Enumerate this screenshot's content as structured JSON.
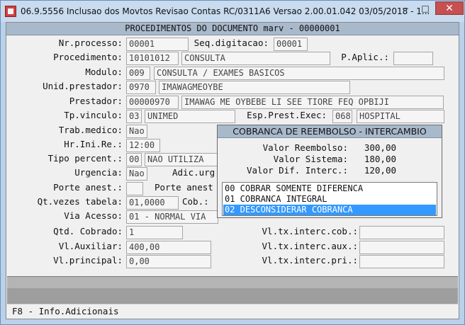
{
  "window": {
    "title": "06.9.5556  Inclusao  dos Movtos Revisao Contas RC/0311A6 Versao 2.00.01.042 03/05/2018 - 1...",
    "minimize": "─",
    "maximize": "□",
    "close": "✕"
  },
  "header": {
    "title": "PROCEDIMENTOS DO DOCUMENTO marv - 00000001"
  },
  "form": {
    "nr_processo": {
      "label": "Nr.processo:",
      "value": "00001"
    },
    "seq_digitacao": {
      "label": "Seq.digitacao:",
      "value": "00001"
    },
    "procedimento": {
      "label": "Procedimento:",
      "code": "10101012",
      "desc": "CONSULTA"
    },
    "p_aplic": {
      "label": "P.Aplic.:",
      "value": ""
    },
    "modulo": {
      "label": "Modulo:",
      "code": "009",
      "desc": "CONSULTA / EXAMES BASICOS"
    },
    "unid_prestador": {
      "label": "Unid.prestador:",
      "code": "0970",
      "desc": "IMAWAGMEOYBE"
    },
    "prestador": {
      "label": "Prestador:",
      "code": "00000970",
      "desc": "IMAWAG ME OYBEBE LI SEE TIORE FEQ OPBIJI"
    },
    "tp_vinculo": {
      "label": "Tp.vinculo:",
      "code": "03",
      "desc": "UNIMED"
    },
    "esp_prest_exec": {
      "label": "Esp.Prest.Exec:",
      "code": "068",
      "desc": "HOSPITAL"
    },
    "trab_medico": {
      "label": "Trab.medico:",
      "value": "Nao"
    },
    "hr_ini_re": {
      "label": "Hr.Ini.Re.:",
      "value": "12:00"
    },
    "tipo_percent": {
      "label": "Tipo percent.:",
      "code": "00",
      "desc": "NAO UTILIZA"
    },
    "urgencia": {
      "label": "Urgencia:",
      "value": "Nao"
    },
    "adic_urg": {
      "label": "Adic.urg"
    },
    "porte_anest": {
      "label": "Porte anest.:",
      "value": ""
    },
    "porte_anest2": {
      "label": "Porte anest"
    },
    "qt_vezes_tabela": {
      "label": "Qt.vezes tabela:",
      "value": "01,0000"
    },
    "cob": {
      "label": "Cob.:"
    },
    "via_acesso": {
      "label": "Via Acesso:",
      "value": "01 - NORMAL VIA"
    },
    "qtd_cobrado": {
      "label": "Qtd. Cobrado:",
      "value": "1"
    },
    "vl_auxiliar": {
      "label": "Vl.Auxiliar:",
      "value": "400,00"
    },
    "vl_principal": {
      "label": "Vl.principal:",
      "value": "0,00"
    },
    "vl_tx_interc_cob": {
      "label": "Vl.tx.interc.cob.:",
      "value": ""
    },
    "vl_tx_interc_aux": {
      "label": "Vl.tx.interc.aux.:",
      "value": ""
    },
    "vl_tx_interc_pri": {
      "label": "Vl.tx.interc.pri.:",
      "value": ""
    }
  },
  "popup": {
    "title": "COBRANCA DE REEMBOLSO - INTERCAMBIO",
    "valor_reembolso": {
      "label": "Valor Reembolso:",
      "value": "300,00"
    },
    "valor_sistema": {
      "label": "Valor Sistema:",
      "value": "180,00"
    },
    "valor_dif": {
      "label": "Valor Dif. Interc.:",
      "value": "120,00"
    },
    "options": [
      "00 COBRAR SOMENTE DIFERENCA",
      "01 COBRANCA INTEGRAL",
      "02 DESCONSIDERAR COBRANCA"
    ],
    "selected": "02 DESCONSIDERAR COBRANCA"
  },
  "footer": {
    "text": "F8 - Info.Adicionais"
  }
}
